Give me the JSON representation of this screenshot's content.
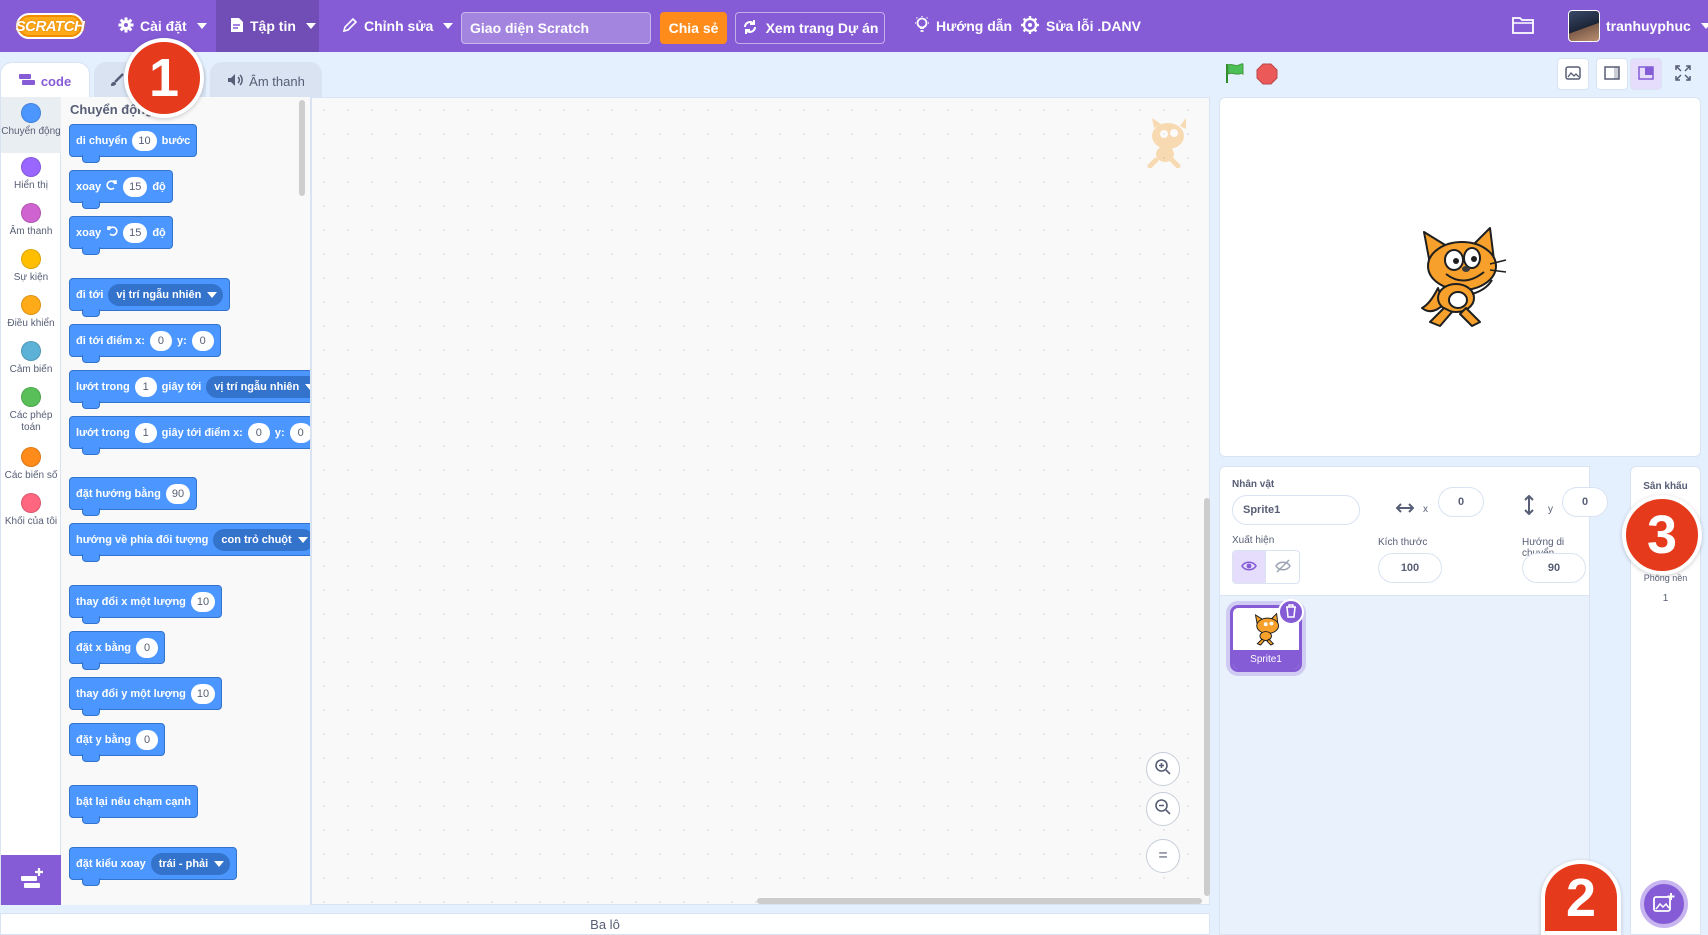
{
  "menu": {
    "logo": "SCRATCH",
    "settings": "Cài đặt",
    "file": "Tập tin",
    "edit": "Chỉnh sửa",
    "project_title": "Giao diện Scratch",
    "share": "Chia sẻ",
    "see_project": "Xem trang Dự án",
    "tutorials": "Hướng dẫn",
    "debug": "Sửa lỗi .DANV",
    "username": "tranhuyphuc"
  },
  "tabs": {
    "code": "code",
    "costumes": "",
    "sounds": "Âm thanh"
  },
  "categories": [
    {
      "label": "Chuyển động",
      "color": "#4c97ff"
    },
    {
      "label": "Hiển thị",
      "color": "#9966ff"
    },
    {
      "label": "Âm thanh",
      "color": "#cf63cf"
    },
    {
      "label": "Sự kiện",
      "color": "#ffbf00"
    },
    {
      "label": "Điều khiển",
      "color": "#ffab19"
    },
    {
      "label": "Cảm biến",
      "color": "#5cb1d6"
    },
    {
      "label": "Các phép toán",
      "color": "#59c059"
    },
    {
      "label": "Các biến số",
      "color": "#ff8c1a"
    },
    {
      "label": "Khối của tôi",
      "color": "#ff6680"
    }
  ],
  "palette": {
    "heading": "Chuyển động",
    "blocks": {
      "move": {
        "a": "di chuyển",
        "v": "10",
        "b": "bước"
      },
      "turn_right": {
        "a": "xoay",
        "v": "15",
        "b": "độ"
      },
      "turn_left": {
        "a": "xoay",
        "v": "15",
        "b": "độ"
      },
      "goto": {
        "a": "đi tới",
        "dd": "vị trí ngẫu nhiên"
      },
      "goto_xy": {
        "a": "đi tới điểm x:",
        "x": "0",
        "b": "y:",
        "y": "0"
      },
      "glide": {
        "a": "lướt trong",
        "v": "1",
        "b": "giây tới",
        "dd": "vị trí ngẫu nhiên"
      },
      "glide_xy": {
        "a": "lướt trong",
        "v": "1",
        "b": "giây tới điểm x:",
        "x": "0",
        "c": "y:",
        "y": "0"
      },
      "point_dir": {
        "a": "đặt hướng bằng",
        "v": "90"
      },
      "point_towards": {
        "a": "hướng về phía đối tượng",
        "dd": "con trỏ chuột"
      },
      "change_x": {
        "a": "thay đổi x một lượng",
        "v": "10"
      },
      "set_x": {
        "a": "đặt x bằng",
        "v": "0"
      },
      "change_y": {
        "a": "thay đổi y một lượng",
        "v": "10"
      },
      "set_y": {
        "a": "đặt y bằng",
        "v": "0"
      },
      "bounce": {
        "a": "bật lại nếu chạm cạnh"
      },
      "rotation_style": {
        "a": "đặt kiểu xoay",
        "dd": "trái - phải"
      }
    }
  },
  "zoom": {
    "reset": "="
  },
  "backpack": "Ba lô",
  "sprite": {
    "label": "Nhân vật",
    "name": "Sprite1",
    "x_label": "x",
    "x": "0",
    "y_label": "y",
    "y": "0",
    "show_label": "Xuất hiện",
    "size_label": "Kích thước",
    "size": "100",
    "direction_label": "Hướng di chuyển",
    "direction": "90",
    "tile_name": "Sprite1"
  },
  "stage_panel": {
    "title": "Sân khấu",
    "backdrops_label": "Phông nền",
    "backdrops_count": "1"
  },
  "badges": [
    "1",
    "2",
    "3"
  ],
  "colors": {
    "accent": "#855cd6",
    "motion": "#4c97ff",
    "share": "#ff8c1a",
    "badge": "#e53a1c"
  }
}
